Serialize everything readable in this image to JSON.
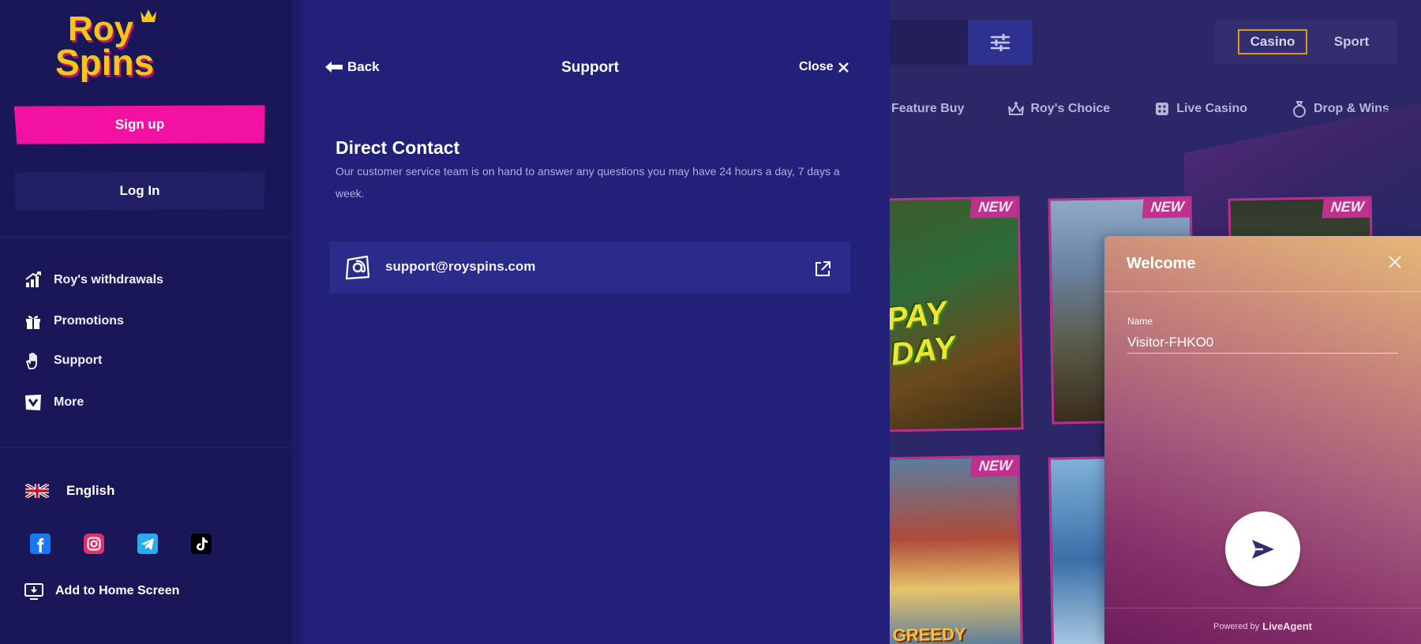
{
  "colors": {
    "sidebar_bg": "#1a1758",
    "panel_bg": "#222079",
    "signup_pink": "#f311a3",
    "logo_yellow": "#f5c518",
    "badge_magenta": "#c2308f"
  },
  "logo": {
    "line1": "Roy",
    "line2": "Spins"
  },
  "sidebar": {
    "signup_label": "Sign up",
    "login_label": "Log In",
    "nav": [
      {
        "label": "Roy's withdrawals",
        "icon": "chart-up-icon"
      },
      {
        "label": "Promotions",
        "icon": "gift-icon"
      },
      {
        "label": "Support",
        "icon": "hand-icon"
      },
      {
        "label": "More",
        "icon": "chevron-box-icon"
      }
    ],
    "language": "English",
    "socials": [
      "facebook-icon",
      "instagram-icon",
      "telegram-icon",
      "tiktok-icon"
    ],
    "add_home": "Add to Home Screen"
  },
  "header": {
    "modes": [
      "Casino",
      "Sport"
    ],
    "active_mode": "Casino"
  },
  "categories": [
    "Feature Buy",
    "Roy's Choice",
    "Live Casino",
    "Drop & Wins"
  ],
  "tiles": {
    "badge": "NEW",
    "titles": [
      "PAY DAY",
      "GREEDY ALICE"
    ]
  },
  "support_panel": {
    "back_label": "Back",
    "title": "Support",
    "close_label": "Close",
    "section_title": "Direct Contact",
    "section_desc": "Our customer service team is on hand to answer any questions you may have 24 hours a day, 7 days a week.",
    "email": "support@royspins.com"
  },
  "chat": {
    "title": "Welcome",
    "name_label": "Name",
    "name_value": "Visitor-FHKO0",
    "powered_by": "Powered by",
    "brand": "LiveAgent"
  }
}
